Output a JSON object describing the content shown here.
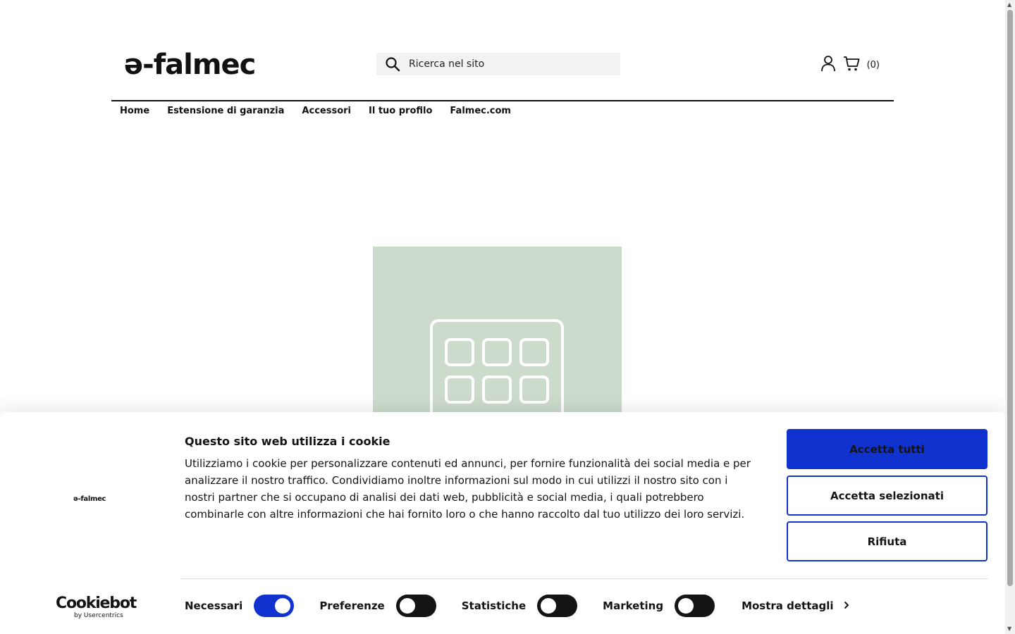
{
  "header": {
    "logo_text": "ə-falmec",
    "search_placeholder": "Ricerca nel sito",
    "cart_count": "(0)"
  },
  "nav": {
    "items": [
      "Home",
      "Estensione di garanzia",
      "Accessori",
      "Il tuo profilo",
      "Falmec.com"
    ]
  },
  "cookie_banner": {
    "logo_text": "ə-falmec",
    "title": "Questo sito web utilizza i cookie",
    "body": "Utilizziamo i cookie per personalizzare contenuti ed annunci, per fornire funzionalità dei social media e per analizzare il nostro traffico. Condividiamo inoltre informazioni sul modo in cui utilizzi il nostro sito con i nostri partner che si occupano di analisi dei dati web, pubblicità e social media, i quali potrebbero combinarle con altre informazioni che hai fornito loro o che hanno raccolto dal tuo utilizzo dei loro servizi.",
    "buttons": {
      "accept_all": "Accetta tutti",
      "accept_selected": "Accetta selezionati",
      "reject": "Rifiuta"
    },
    "toggles": [
      {
        "label": "Necessari",
        "on": true
      },
      {
        "label": "Preferenze",
        "on": false
      },
      {
        "label": "Statistiche",
        "on": false
      },
      {
        "label": "Marketing",
        "on": false
      }
    ],
    "details_label": "Mostra dettagli",
    "cookiebot_main": "Cookiebot",
    "cookiebot_sub": "by Usercentrics"
  },
  "colors": {
    "accent_blue": "#1032cf",
    "hero_bg": "#cddbcd",
    "text": "#141414"
  }
}
